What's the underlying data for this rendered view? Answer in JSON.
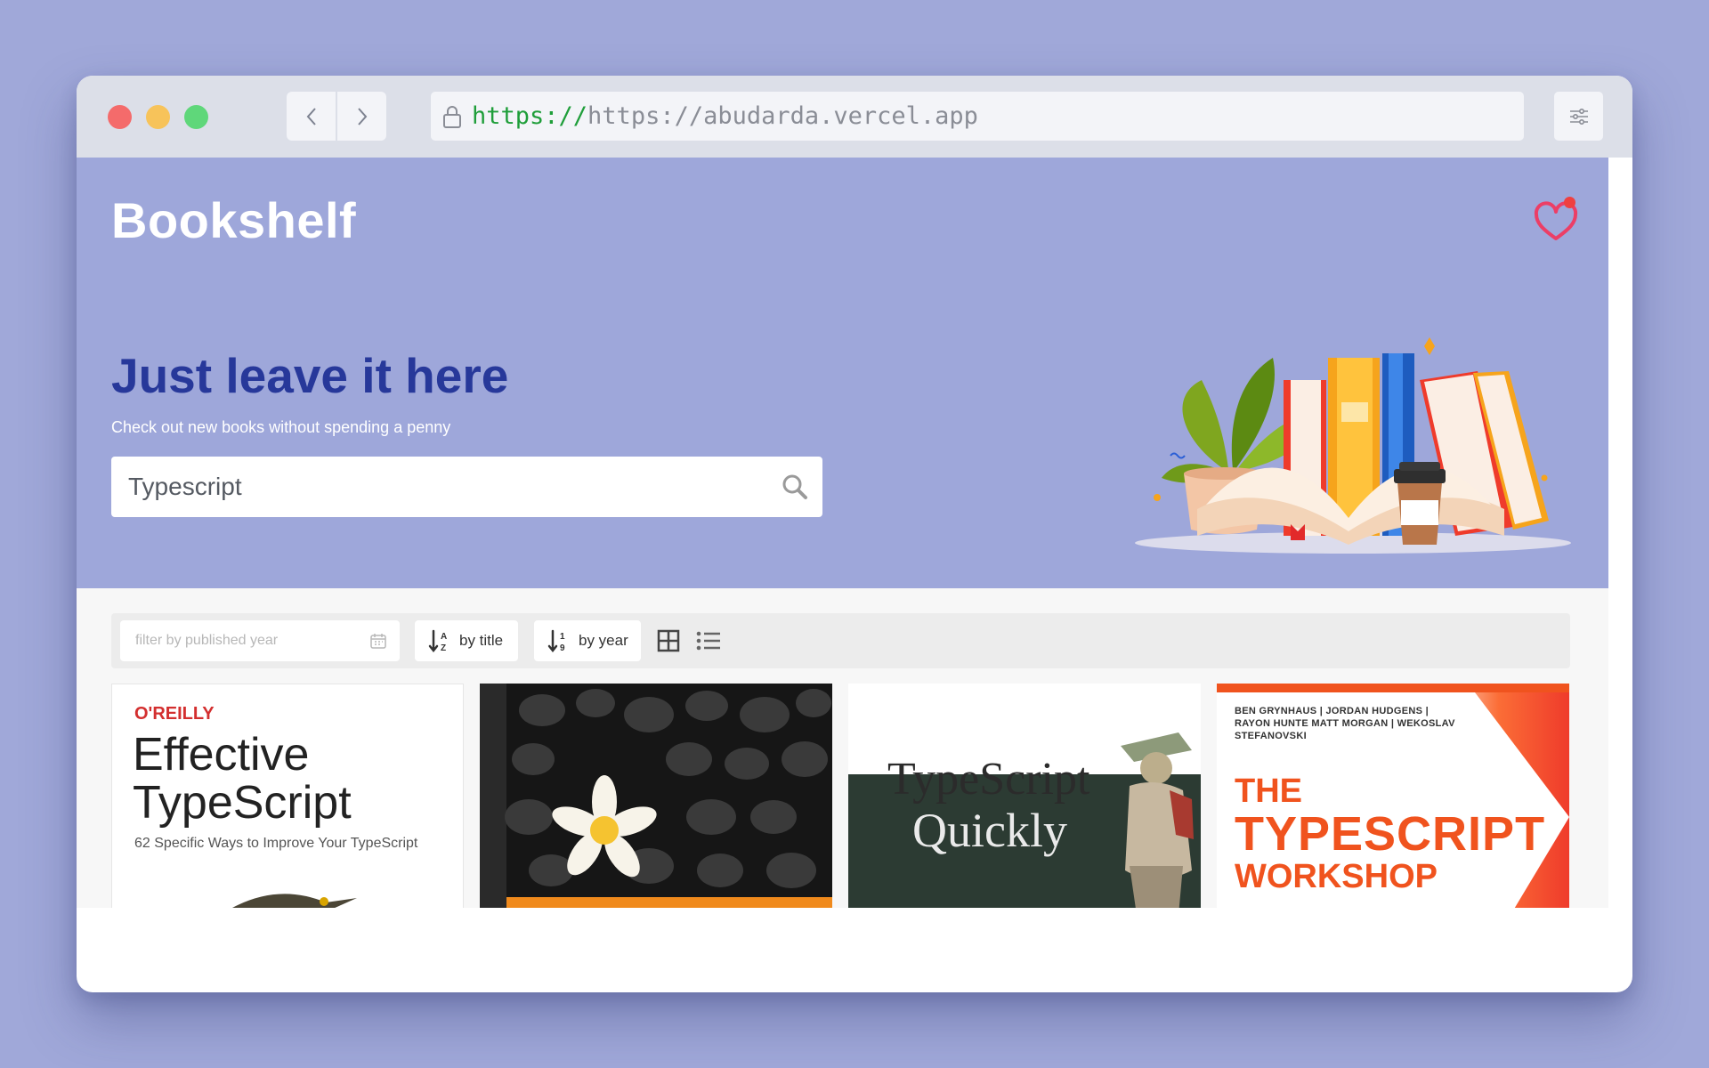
{
  "browser": {
    "url_scheme": "https://",
    "url_host": "https://abudarda.vercel.app"
  },
  "app": {
    "brand": "Bookshelf"
  },
  "hero": {
    "headline": "Just leave it here",
    "subline": "Check out new books without spending a penny",
    "search_value": "Typescript"
  },
  "toolbar": {
    "year_filter_placeholder": "filter by published year",
    "sort_title_label": "by title",
    "sort_year_label": "by year"
  },
  "books": [
    {
      "publisher": "O'REILLY",
      "title_line1": "Effective",
      "title_line2": "TypeScript",
      "subtitle": "62 Specific Ways to Improve Your TypeScript"
    },
    {
      "cover": "black stones with white flower"
    },
    {
      "title_line1": "TypeScript",
      "title_line2": "Quickly"
    },
    {
      "authors": "BEN GRYNHAUS | JORDAN HUDGENS | RAYON HUNTE MATT MORGAN | WEKOSLAV STEFANOVSKI",
      "the": "THE",
      "title": "TYPESCRIPT",
      "subtitle": "WORKSHOP"
    }
  ],
  "colors": {
    "page_bg": "#a0a8d9",
    "hero_bg": "#9ea7da",
    "headline": "#27389a",
    "accent_heart": "#ef4040"
  }
}
